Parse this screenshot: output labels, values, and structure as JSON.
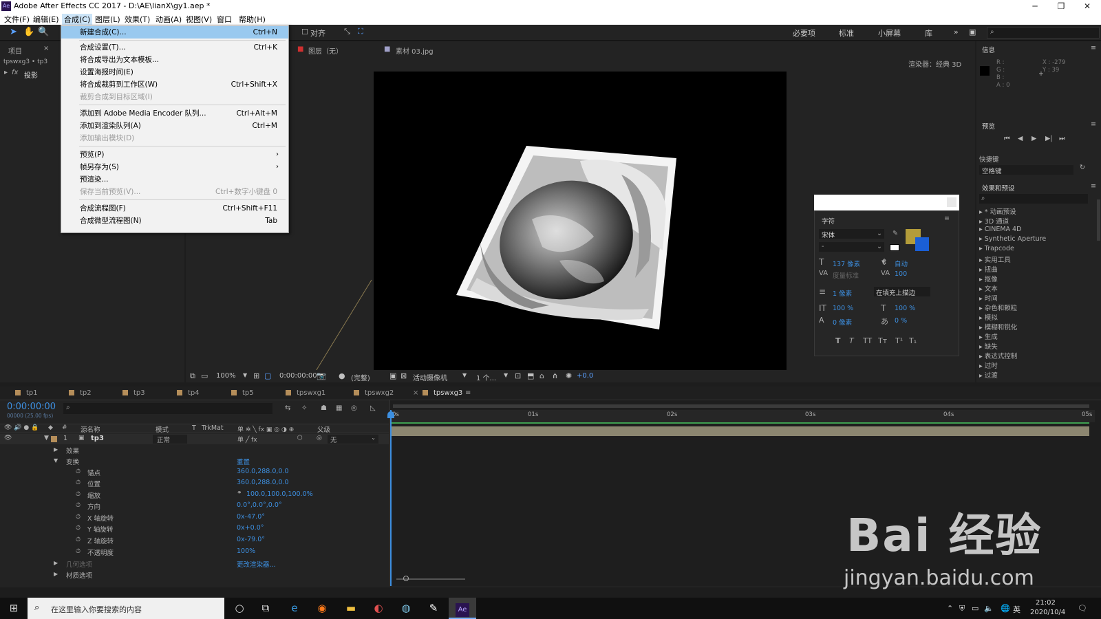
{
  "window": {
    "title": "Adobe After Effects CC 2017 - D:\\AE\\lianX\\gy1.aep *",
    "app_icon": "Ae"
  },
  "menubar": [
    "文件(F)",
    "编辑(E)",
    "合成(C)",
    "图层(L)",
    "效果(T)",
    "动画(A)",
    "视图(V)",
    "窗口",
    "帮助(H)"
  ],
  "toolbar": {
    "align_label": "对齐",
    "workspaces": [
      "必要项",
      "标准",
      "小屏幕",
      "库"
    ]
  },
  "comp_menu": [
    {
      "label": "新建合成(C)...",
      "shortcut": "Ctrl+N",
      "highlighted": true
    },
    {
      "label": "合成设置(T)...",
      "shortcut": "Ctrl+K"
    },
    {
      "label": "将合成导出为文本模板...",
      "shortcut": ""
    },
    {
      "label": "设置海报时间(E)",
      "shortcut": ""
    },
    {
      "label": "将合成裁剪到工作区(W)",
      "shortcut": "Ctrl+Shift+X"
    },
    {
      "label": "裁剪合成到目标区域(I)",
      "shortcut": "",
      "disabled": true
    },
    {
      "label": "添加到 Adobe Media Encoder 队列...",
      "shortcut": "Ctrl+Alt+M"
    },
    {
      "label": "添加到渲染队列(A)",
      "shortcut": "Ctrl+M"
    },
    {
      "label": "添加输出模块(D)",
      "shortcut": "",
      "disabled": true
    },
    {
      "label": "预览(P)",
      "shortcut": ""
    },
    {
      "label": "帧另存为(S)",
      "shortcut": ""
    },
    {
      "label": "预渲染...",
      "shortcut": ""
    },
    {
      "label": "保存当前预览(V)...",
      "shortcut": "Ctrl+数字小键盘 0",
      "disabled": true
    },
    {
      "label": "合成流程图(F)",
      "shortcut": "Ctrl+Shift+F11"
    },
    {
      "label": "合成微型流程图(N)",
      "shortcut": "Tab"
    }
  ],
  "project_panel": {
    "tab": "项目",
    "breadcrumb": "tpswxg3 • tp3",
    "fx_item": "投影"
  },
  "viewer_tabs": {
    "layer": "图层（无）",
    "footage": "素材 03.jpg",
    "renderer": "渲染器：",
    "renderer_value": "经典 3D"
  },
  "viewer_bar": {
    "zoom": "100%",
    "time": "0:00:00:00",
    "quality": "(完整)",
    "camera": "活动摄像机",
    "views": "1 个...",
    "exposure": "+0.0"
  },
  "char_panel": {
    "title": "字符",
    "font": "宋体",
    "style": "-",
    "size": "137 像素",
    "leading": "自动",
    "kerning": "度量标准",
    "tracking": "100",
    "stroke": "1 像素",
    "stroke_mode": "在填充上描边",
    "vscale": "100 %",
    "hscale": "100 %",
    "baseline": "0 像素",
    "tsume": "0 %",
    "styles": [
      "T",
      "T",
      "TT",
      "Tт",
      "T¹",
      "T₁"
    ],
    "fill_color": "#b39c3a",
    "stroke_color": "#1a5fd6"
  },
  "info_panel": {
    "title": "信息",
    "r": "R :",
    "g": "G :",
    "b": "B :",
    "a": "A : 0",
    "x": "X : -279",
    "y": "Y : 39"
  },
  "preview_panel": {
    "title": "预览",
    "shortcut_label": "快捷键",
    "shortcut_value": "空格键"
  },
  "effects_panel": {
    "title": "效果和预设",
    "items": [
      "* 动画预设",
      "3D 通道",
      "CINEMA 4D",
      "Synthetic Aperture",
      "Trapcode",
      "实用工具",
      "扭曲",
      "抠像",
      "文本",
      "时间",
      "杂色和颗粒",
      "模拟",
      "模糊和锐化",
      "生成",
      "缺失",
      "表达式控制",
      "过时",
      "过渡"
    ]
  },
  "timeline": {
    "tabs": [
      {
        "label": "tp1",
        "color": "#b58e5a"
      },
      {
        "label": "tp2",
        "color": "#b58e5a"
      },
      {
        "label": "tp3",
        "color": "#b58e5a"
      },
      {
        "label": "tp4",
        "color": "#b58e5a"
      },
      {
        "label": "tp5",
        "color": "#b58e5a"
      },
      {
        "label": "tpswxg1",
        "color": "#b58e5a"
      },
      {
        "label": "tpswxg2",
        "color": "#b58e5a"
      },
      {
        "label": "tpswxg3",
        "color": "#b58e5a"
      }
    ],
    "timecode": "0:00:00:00",
    "fps": "00000 (25.00 fps)",
    "headers": {
      "name": "源名称",
      "mode": "模式",
      "t": "T",
      "trkmat": "TrkMat",
      "parent": "父级"
    },
    "ruler": [
      "0s",
      "01s",
      "02s",
      "03s",
      "04s",
      "05s"
    ],
    "layer": {
      "num": "1",
      "name": "tp3",
      "mode": "正常",
      "parent": "无"
    },
    "effects": "效果",
    "transform": "变换",
    "reset": "重置",
    "props": [
      {
        "name": "锚点",
        "value": "360.0,288.0,0.0"
      },
      {
        "name": "位置",
        "value": "360.0,288.0,0.0"
      },
      {
        "name": "缩放",
        "value": "100.0,100.0,100.0%"
      },
      {
        "name": "方向",
        "value": "0.0°,0.0°,0.0°"
      },
      {
        "name": "X 轴旋转",
        "value": "0x-47.0°"
      },
      {
        "name": "Y 轴旋转",
        "value": "0x+0.0°"
      },
      {
        "name": "Z 轴旋转",
        "value": "0x-79.0°"
      },
      {
        "name": "不透明度",
        "value": "100%"
      }
    ],
    "geometry": "几何选项",
    "renderer_change": "更改渲染器...",
    "material": "材质选项"
  },
  "taskbar": {
    "search_placeholder": "在这里输入你要搜索的内容",
    "time": "21:02",
    "date": "2020/10/4",
    "ime": "英"
  },
  "watermark": {
    "text": "Bai 经验",
    "url": "jingyan.baidu.com"
  }
}
